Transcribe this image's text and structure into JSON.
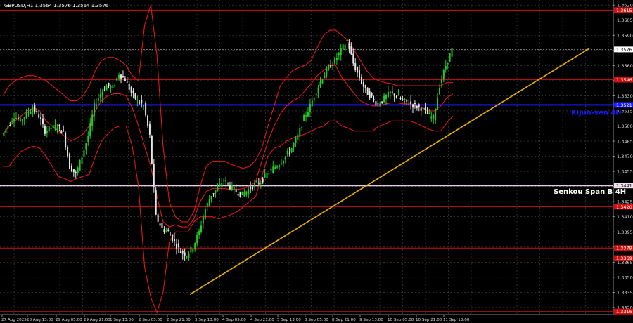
{
  "symbol_line": "GBPUSD,H1  1.3564 1.3576 1.3564 1.3576",
  "y_range": [
    1.3313,
    1.3625
  ],
  "price_ticks": [
    "1.3620",
    "1.3605",
    "1.3590",
    "1.3575",
    "1.3560",
    "1.3545",
    "1.3530",
    "1.3515",
    "1.3500",
    "1.3485",
    "1.3470",
    "1.3455",
    "1.3440",
    "1.3425",
    "1.3410",
    "1.3395",
    "1.3380",
    "1.3365",
    "1.3350",
    "1.3335",
    "1.3320"
  ],
  "time_labels": [
    "27 Aug 2025",
    "28 Aug 13:00",
    "29 Aug 05:00",
    "29 Aug 21:00",
    "1 Sep 13:00",
    "2 Sep 05:00",
    "2 Sep 21:00",
    "3 Sep 13:00",
    "4 Sep 05:00",
    "4 Sep 21:00",
    "5 Sep 13:00",
    "8 Sep 05:00",
    "8 Sep 21:00",
    "9 Sep 13:00",
    "10 Sep 05:00",
    "10 Sep 21:00",
    "11 Sep 13:00"
  ],
  "current_price": {
    "value": 1.3576,
    "label": "1.3576"
  },
  "levels": [
    {
      "name": "resistance-level-1",
      "value": 1.3615,
      "label": "1.3615",
      "color": "#d01010",
      "kind": "red"
    },
    {
      "name": "resistance-level-2",
      "value": 1.3546,
      "label": "1.3546",
      "color": "#d01010",
      "kind": "red"
    },
    {
      "name": "kijun-sen-level",
      "value": 1.3521,
      "label": "1.3521",
      "color": "#1a1aff",
      "kind": "blue"
    },
    {
      "name": "senkou-span-b-level",
      "value": 1.3441,
      "label": "1.3441",
      "color": "#e8c8e8",
      "kind": "pink"
    },
    {
      "name": "support-level-1",
      "value": 1.342,
      "label": "1.3420",
      "color": "#d01010",
      "kind": "red"
    },
    {
      "name": "support-level-2",
      "value": 1.3379,
      "label": "1.3379",
      "color": "#d01010",
      "kind": "red"
    },
    {
      "name": "support-level-3",
      "value": 1.3369,
      "label": "1.3369",
      "color": "#d01010",
      "kind": "red"
    },
    {
      "name": "support-level-4",
      "value": 1.3316,
      "label": "1.3316",
      "color": "#d01010",
      "kind": "red"
    }
  ],
  "annotations": [
    {
      "name": "kijun-sen-annotation",
      "text": "Kijun-sen 4H",
      "color": "#1a1aff"
    },
    {
      "name": "senkou-span-b-annotation",
      "text": "Senkou Span B 4H",
      "color": "#ffffff"
    }
  ],
  "trendline": {
    "start": {
      "date": "3 Sep 13:00",
      "price": 1.3333
    },
    "end": {
      "date": "11 Sep",
      "price": 1.3577
    },
    "color": "#e8b000"
  },
  "chart_data": {
    "type": "line",
    "series": [
      {
        "values": [
          1.349,
          1.35,
          1.351,
          1.3505,
          1.3512,
          1.3518,
          1.351,
          1.3495,
          1.3498,
          1.35,
          1.3493,
          1.346,
          1.3452,
          1.347,
          1.349,
          1.352,
          1.3532,
          1.354,
          1.3538,
          1.3552,
          1.3546,
          1.3533,
          1.3525,
          1.352,
          1.349,
          1.341,
          1.3398,
          1.3395,
          1.3385,
          1.3375,
          1.3372,
          1.338,
          1.3395,
          1.3418,
          1.3432,
          1.3438,
          1.3447,
          1.344,
          1.3435,
          1.3432,
          1.3437,
          1.3442,
          1.3445,
          1.3452,
          1.3458,
          1.3463,
          1.347,
          1.3478,
          1.349,
          1.3508,
          1.352,
          1.3535,
          1.3548,
          1.3558,
          1.3565,
          1.3575,
          1.3585,
          1.3562,
          1.3548,
          1.3535,
          1.3528,
          1.3522,
          1.3527,
          1.3533,
          1.353,
          1.3525,
          1.3523,
          1.352,
          1.3518,
          1.3512,
          1.3508,
          1.354,
          1.356,
          1.3576
        ]
      },
      {
        "values": [
          1.353,
          1.354,
          1.3545,
          1.3548,
          1.355,
          1.355,
          1.3548,
          1.3545,
          1.354,
          1.3535,
          1.353,
          1.3525,
          1.3525,
          1.353,
          1.354,
          1.3555,
          1.3565,
          1.3568,
          1.3568,
          1.3565,
          1.356,
          1.355,
          1.3545,
          1.36,
          1.362,
          1.357,
          1.348,
          1.3425,
          1.341,
          1.3405,
          1.3405,
          1.3415,
          1.344,
          1.346,
          1.3465,
          1.3465,
          1.3465,
          1.3462,
          1.346,
          1.3458,
          1.346,
          1.3466,
          1.3478,
          1.35,
          1.352,
          1.354,
          1.3548,
          1.3555,
          1.3558,
          1.356,
          1.3565,
          1.3578,
          1.359,
          1.3595,
          1.3595,
          1.359,
          1.3585,
          1.3575,
          1.3565,
          1.3555,
          1.3548,
          1.3545,
          1.3543,
          1.3542,
          1.354,
          1.354,
          1.354,
          1.354,
          1.354,
          1.354,
          1.354,
          1.354,
          1.3543,
          1.3543
        ]
      },
      {
        "values": [
          1.346,
          1.346,
          1.3468,
          1.3475,
          1.3478,
          1.348,
          1.3478,
          1.347,
          1.346,
          1.345,
          1.3448,
          1.3445,
          1.3448,
          1.345,
          1.3452,
          1.347,
          1.3485,
          1.3492,
          1.3498,
          1.35,
          1.35,
          1.348,
          1.344,
          1.336,
          1.333,
          1.3315,
          1.3335,
          1.3385,
          1.3395,
          1.3395,
          1.3395,
          1.3405,
          1.341,
          1.341,
          1.341,
          1.3408,
          1.341,
          1.3412,
          1.3415,
          1.342,
          1.3425,
          1.343,
          1.345,
          1.347,
          1.3478,
          1.348,
          1.3485,
          1.3488,
          1.349,
          1.3492,
          1.3495,
          1.3498,
          1.35,
          1.3505,
          1.3505,
          1.35,
          1.3498,
          1.3495,
          1.3495,
          1.3495,
          1.3495,
          1.35,
          1.3502,
          1.3505,
          1.3505,
          1.3505,
          1.3505,
          1.3503,
          1.35,
          1.3497,
          1.3495,
          1.3495,
          1.3503,
          1.351
        ]
      },
      {
        "values": [
          1.3492,
          1.35,
          1.3505,
          1.351,
          1.3515,
          1.3518,
          1.3515,
          1.3505,
          1.35,
          1.3495,
          1.349,
          1.3485,
          1.3488,
          1.3492,
          1.35,
          1.3515,
          1.3525,
          1.353,
          1.3532,
          1.3532,
          1.353,
          1.3518,
          1.35,
          1.348,
          1.346,
          1.343,
          1.3405,
          1.34,
          1.3402,
          1.34,
          1.34,
          1.3408,
          1.3425,
          1.3435,
          1.3438,
          1.3438,
          1.3438,
          1.3437,
          1.3437,
          1.3438,
          1.344,
          1.3445,
          1.3465,
          1.3485,
          1.35,
          1.3512,
          1.352,
          1.3525,
          1.3528,
          1.3535,
          1.3542,
          1.355,
          1.3555,
          1.356,
          1.356,
          1.3548,
          1.354,
          1.3532,
          1.3525,
          1.3522,
          1.352,
          1.352,
          1.3522,
          1.3523,
          1.3523,
          1.3522,
          1.3522,
          1.352,
          1.3518,
          1.3515,
          1.3515,
          1.352,
          1.3528,
          1.3532
        ]
      }
    ],
    "ylim": [
      1.3313,
      1.3625
    ]
  }
}
